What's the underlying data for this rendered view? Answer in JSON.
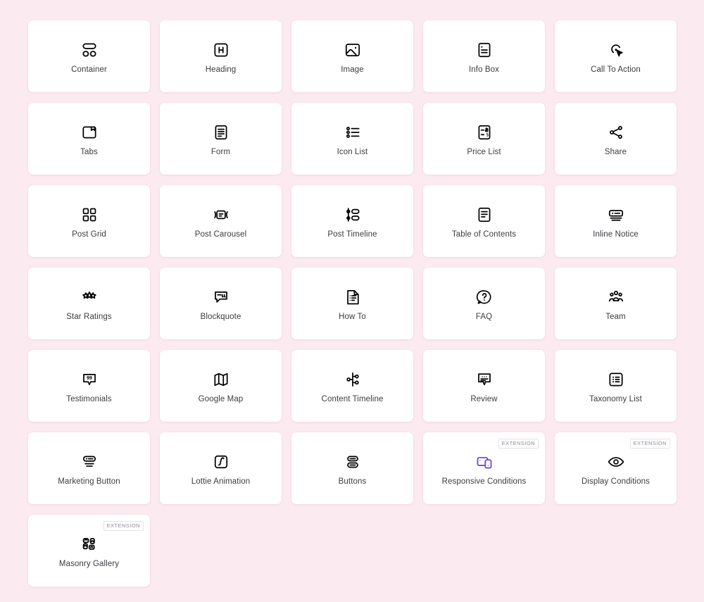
{
  "page": {
    "background_color": "#fceaf1",
    "card_color": "#ffffff",
    "label_color": "#3c3c42",
    "accent_color": "#6c3fd0",
    "badge_label": "EXTENSION"
  },
  "widgets": [
    {
      "label": "Container",
      "icon": "container-icon",
      "extension": false,
      "accent": false
    },
    {
      "label": "Heading",
      "icon": "heading-icon",
      "extension": false,
      "accent": false
    },
    {
      "label": "Image",
      "icon": "image-icon",
      "extension": false,
      "accent": false
    },
    {
      "label": "Info Box",
      "icon": "info-box-icon",
      "extension": false,
      "accent": false
    },
    {
      "label": "Call To Action",
      "icon": "cursor-click-icon",
      "extension": false,
      "accent": false
    },
    {
      "label": "Tabs",
      "icon": "tabs-icon",
      "extension": false,
      "accent": false
    },
    {
      "label": "Form",
      "icon": "form-icon",
      "extension": false,
      "accent": false
    },
    {
      "label": "Icon List",
      "icon": "icon-list-icon",
      "extension": false,
      "accent": false
    },
    {
      "label": "Price List",
      "icon": "price-list-icon",
      "extension": false,
      "accent": false
    },
    {
      "label": "Share",
      "icon": "share-icon",
      "extension": false,
      "accent": false
    },
    {
      "label": "Post Grid",
      "icon": "post-grid-icon",
      "extension": false,
      "accent": false
    },
    {
      "label": "Post Carousel",
      "icon": "post-carousel-icon",
      "extension": false,
      "accent": false
    },
    {
      "label": "Post Timeline",
      "icon": "post-timeline-icon",
      "extension": false,
      "accent": false
    },
    {
      "label": "Table of Contents",
      "icon": "table-of-contents-icon",
      "extension": false,
      "accent": false
    },
    {
      "label": "Inline Notice",
      "icon": "inline-notice-icon",
      "extension": false,
      "accent": false
    },
    {
      "label": "Star Ratings",
      "icon": "star-ratings-icon",
      "extension": false,
      "accent": false
    },
    {
      "label": "Blockquote",
      "icon": "blockquote-icon",
      "extension": false,
      "accent": false
    },
    {
      "label": "How To",
      "icon": "how-to-icon",
      "extension": false,
      "accent": false
    },
    {
      "label": "FAQ",
      "icon": "faq-icon",
      "extension": false,
      "accent": false
    },
    {
      "label": "Team",
      "icon": "team-icon",
      "extension": false,
      "accent": false
    },
    {
      "label": "Testimonials",
      "icon": "testimonials-icon",
      "extension": false,
      "accent": false
    },
    {
      "label": "Google Map",
      "icon": "map-icon",
      "extension": false,
      "accent": false
    },
    {
      "label": "Content Timeline",
      "icon": "content-timeline-icon",
      "extension": false,
      "accent": false
    },
    {
      "label": "Review",
      "icon": "review-icon",
      "extension": false,
      "accent": false
    },
    {
      "label": "Taxonomy List",
      "icon": "taxonomy-list-icon",
      "extension": false,
      "accent": false
    },
    {
      "label": "Marketing Button",
      "icon": "marketing-button-icon",
      "extension": false,
      "accent": false
    },
    {
      "label": "Lottie Animation",
      "icon": "lottie-animation-icon",
      "extension": false,
      "accent": false
    },
    {
      "label": "Buttons",
      "icon": "buttons-icon",
      "extension": false,
      "accent": false
    },
    {
      "label": "Responsive Conditions",
      "icon": "responsive-conditions-icon",
      "extension": true,
      "accent": true
    },
    {
      "label": "Display Conditions",
      "icon": "eye-icon",
      "extension": true,
      "accent": false
    },
    {
      "label": "Masonry Gallery",
      "icon": "masonry-gallery-icon",
      "extension": true,
      "accent": false
    }
  ]
}
